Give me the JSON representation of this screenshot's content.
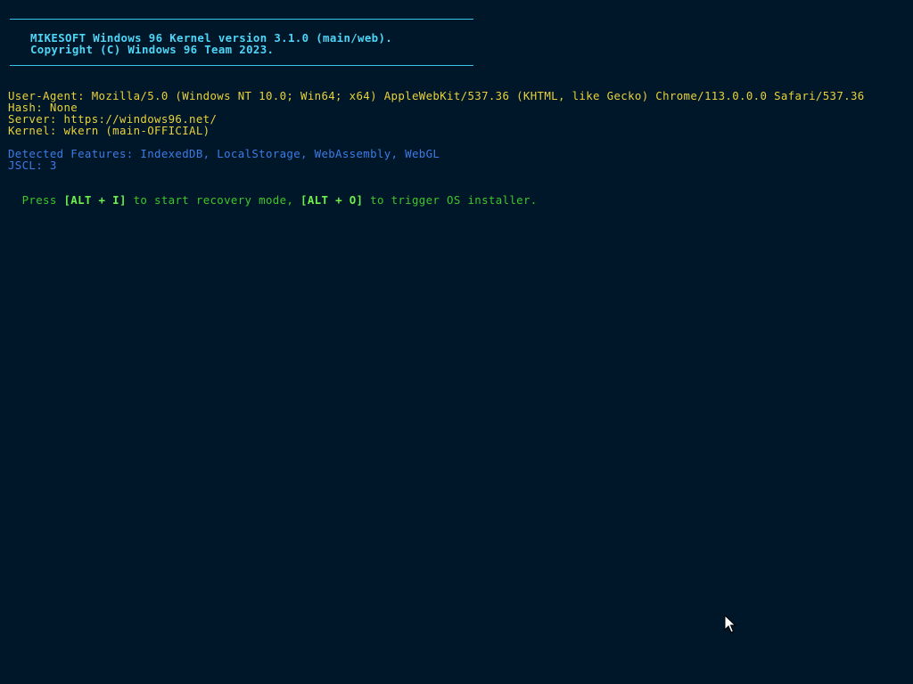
{
  "banner": {
    "title": "MIKESOFT Windows 96 Kernel version 3.1.0 (main/web).",
    "copyright": "Copyright (C) Windows 96 Team 2023."
  },
  "system_info": {
    "user_agent": "User-Agent: Mozilla/5.0 (Windows NT 10.0; Win64; x64) AppleWebKit/537.36 (KHTML, like Gecko) Chrome/113.0.0.0 Safari/537.36",
    "hash": "Hash: None",
    "server": "Server: https://windows96.net/",
    "kernel": "Kernel: wkern (main-OFFICIAL)"
  },
  "features": {
    "detected": "Detected Features: IndexedDB, LocalStorage, WebAssembly, WebGL",
    "jscl": "JSCL: 3"
  },
  "prompt": {
    "press": "Press ",
    "key_recovery": "[ALT + I]",
    "recovery_text": " to start recovery mode, ",
    "key_installer": "[ALT + O]",
    "installer_text": " to trigger OS installer."
  },
  "colors": {
    "background": "#001629",
    "banner": "#4fd6f7",
    "info": "#e8d23a",
    "features": "#3d7ce6",
    "prompt": "#3ec62c"
  },
  "icons": {
    "cursor": "mouse-pointer-icon"
  }
}
